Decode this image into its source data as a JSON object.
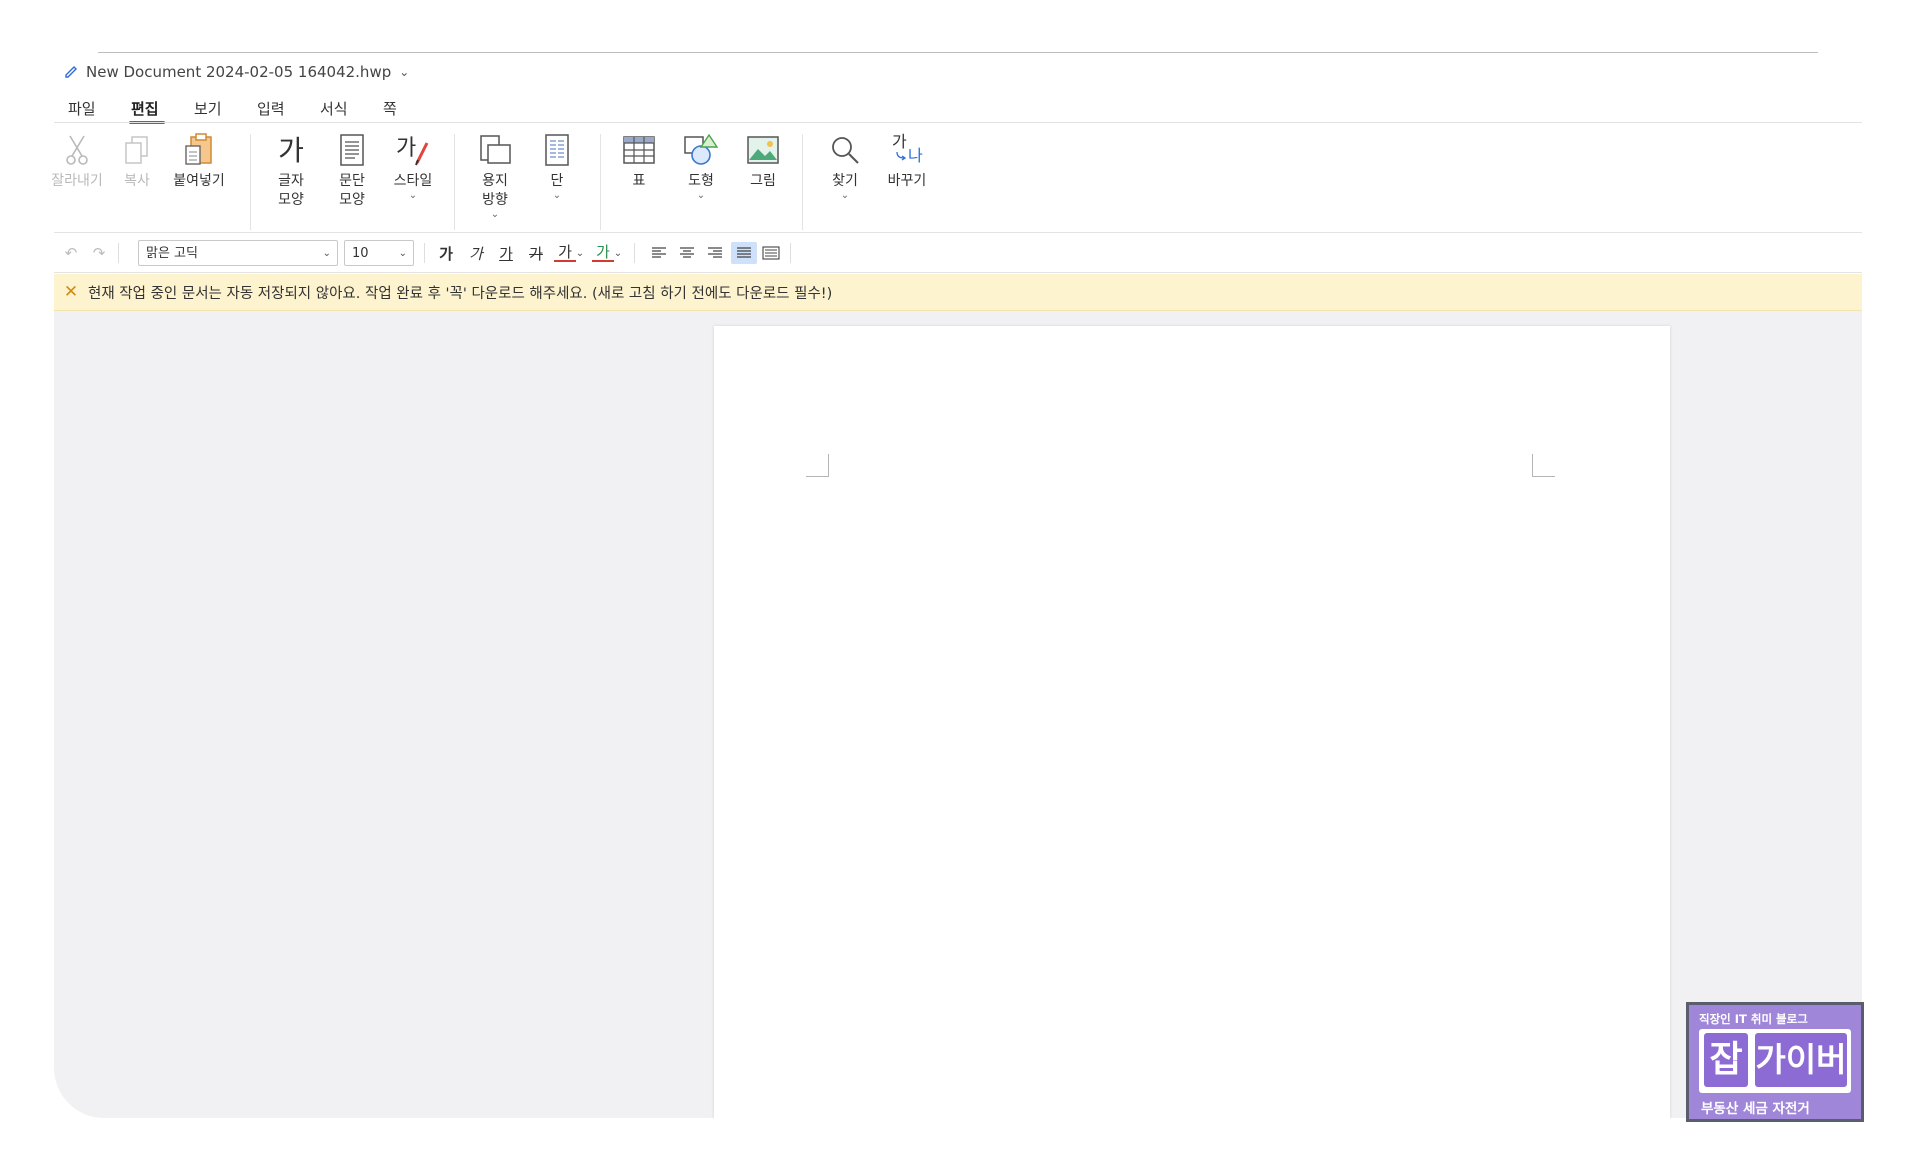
{
  "document": {
    "title": "New Document 2024-02-05 164042.hwp"
  },
  "menu": {
    "tabs": [
      "파일",
      "편집",
      "보기",
      "입력",
      "서식",
      "쪽"
    ],
    "active": "편집"
  },
  "ribbon": {
    "cut": "잘라내기",
    "copy": "복사",
    "paste": "붙여넣기",
    "char_shape": [
      "글자",
      "모양"
    ],
    "para_shape": [
      "문단",
      "모양"
    ],
    "style": "스타일",
    "page_orientation": [
      "용지",
      "방향"
    ],
    "column": "단",
    "table": "표",
    "shape": "도형",
    "picture": "그림",
    "find": "찾기",
    "replace": "바꾸기",
    "char_icon_glyph": "가",
    "replace_icon_glyphs": [
      "가",
      "나"
    ]
  },
  "format": {
    "font_name": "맑은 고딕",
    "font_size": "10",
    "bold_glyph": "가",
    "italic_glyph": "가",
    "underline_glyph": "가",
    "strike_glyph": "가",
    "color_glyph": "가",
    "highlight_glyph": "가"
  },
  "notice": {
    "text": "현재 작업 중인 문서는 자동 저장되지 않아요. 작업 완료 후 '꼭' 다운로드 해주세요. (새로 고침 하기 전에도 다운로드 필수!)"
  },
  "watermark": {
    "top": "직장인 IT 취미 블로그",
    "mark_a": "잡",
    "mark_b": "가이버",
    "bottom": "부동산 세금 자전거"
  },
  "colors": {
    "accent": "#2d6fd6",
    "notice_bg": "#fdf3cf",
    "workspace_bg": "#f1f1f3",
    "badge": "#9f86d8"
  }
}
